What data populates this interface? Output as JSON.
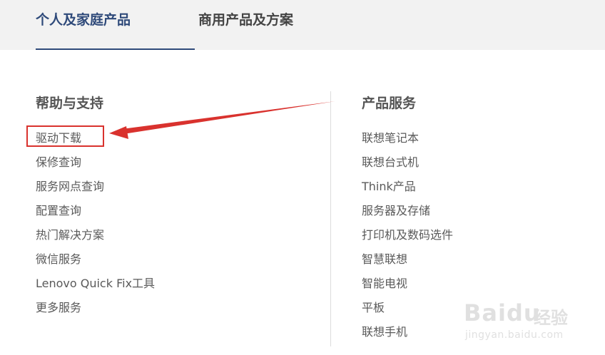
{
  "tabs": {
    "personal": "个人及家庭产品",
    "business": "商用产品及方案"
  },
  "help": {
    "title": "帮助与支持",
    "items": [
      "驱动下载",
      "保修查询",
      "服务网点查询",
      "配置查询",
      "热门解决方案",
      "微信服务",
      "Lenovo Quick Fix工具",
      "更多服务"
    ]
  },
  "products": {
    "title": "产品服务",
    "items": [
      "联想笔记本",
      "联想台式机",
      "Think产品",
      "服务器及存储",
      "打印机及数码选件",
      "智慧联想",
      "智能电视",
      "平板",
      "联想手机"
    ]
  },
  "annotation": {
    "color": "#d9322e"
  },
  "watermark": {
    "logo": "Baidu",
    "brand": "经验",
    "url": "jingyan.baidu.com"
  }
}
